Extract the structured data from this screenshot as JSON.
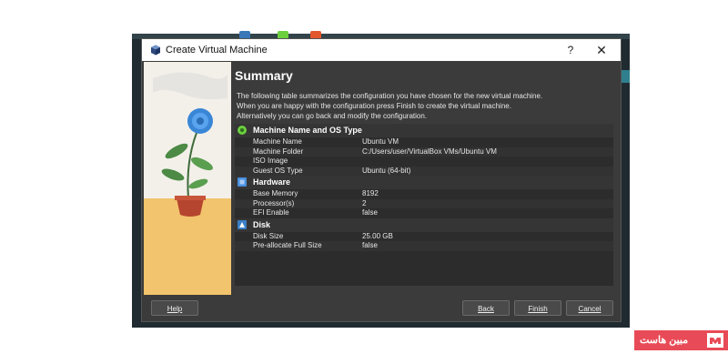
{
  "window": {
    "title": "Create Virtual Machine",
    "help_glyph": "?",
    "close_glyph": "✕"
  },
  "page": {
    "heading": "Summary",
    "description": [
      "The following table summarizes the configuration you have chosen for the new virtual machine.",
      "When you are happy with the configuration press Finish to create the virtual machine.",
      "Alternatively you can go back and modify the configuration."
    ]
  },
  "sections": [
    {
      "title": "Machine Name and OS Type",
      "icon": "gear-icon",
      "rows": [
        {
          "key": "Machine Name",
          "value": "Ubuntu VM"
        },
        {
          "key": "Machine Folder",
          "value": "C:/Users/user/VirtualBox VMs/Ubuntu VM"
        },
        {
          "key": "ISO Image",
          "value": ""
        },
        {
          "key": "Guest OS Type",
          "value": "Ubuntu (64-bit)"
        }
      ]
    },
    {
      "title": "Hardware",
      "icon": "chip-icon",
      "rows": [
        {
          "key": "Base Memory",
          "value": "8192"
        },
        {
          "key": "Processor(s)",
          "value": "2"
        },
        {
          "key": "EFI Enable",
          "value": "false"
        }
      ]
    },
    {
      "title": "Disk",
      "icon": "disk-icon",
      "rows": [
        {
          "key": "Disk Size",
          "value": "25.00 GB"
        },
        {
          "key": "Pre-allocate Full Size",
          "value": "false"
        }
      ]
    }
  ],
  "buttons": {
    "help": "Help",
    "back": "Back",
    "finish": "Finish",
    "cancel": "Cancel"
  },
  "watermark": {
    "text": "مبین هاست"
  },
  "colors": {
    "dialog_bg": "#3b3b3b",
    "accent_green": "#6ccf3e",
    "accent_blue": "#4a90e2",
    "watermark_red": "#e84b57"
  }
}
